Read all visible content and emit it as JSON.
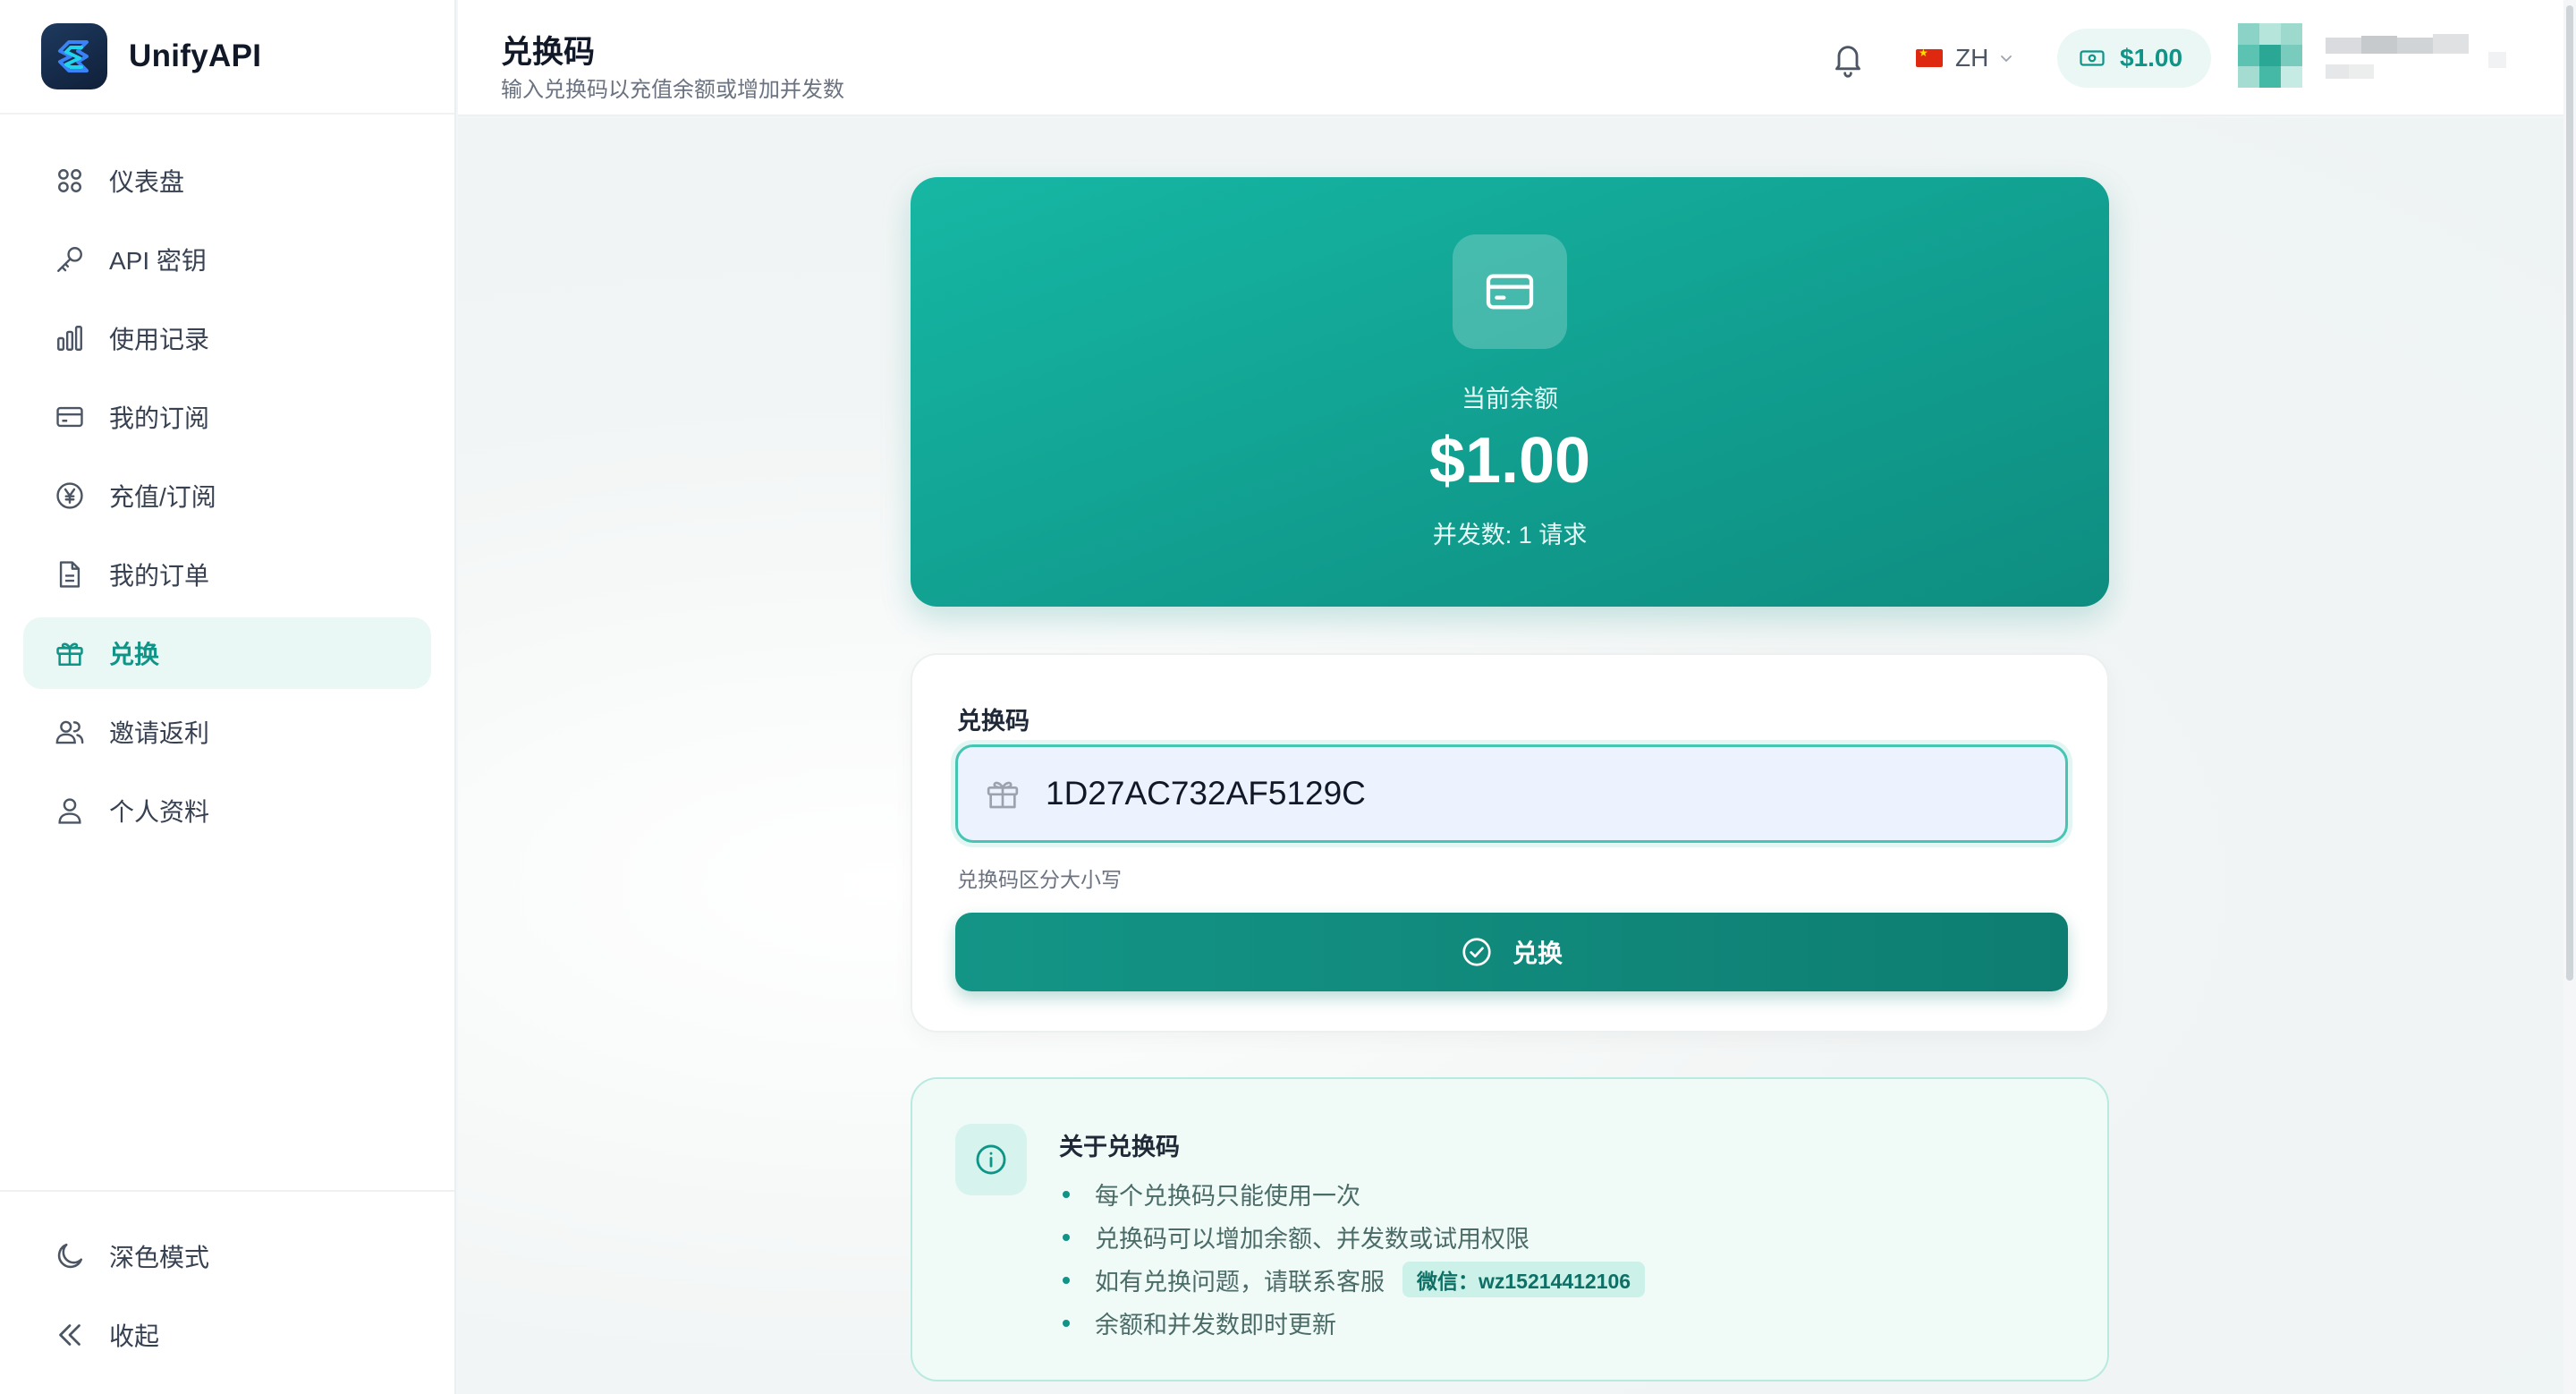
{
  "app": {
    "name": "UnifyAPI"
  },
  "header": {
    "title": "兑换码",
    "subtitle": "输入兑换码以充值余额或增加并发数",
    "language": "ZH",
    "balance": "$1.00"
  },
  "sidebar": {
    "items": [
      {
        "label": "仪表盘",
        "icon": "grid-icon",
        "active": false
      },
      {
        "label": "API 密钥",
        "icon": "key-icon",
        "active": false
      },
      {
        "label": "使用记录",
        "icon": "bar-chart-icon",
        "active": false
      },
      {
        "label": "我的订阅",
        "icon": "card-icon",
        "active": false
      },
      {
        "label": "充值/订阅",
        "icon": "yen-circle-icon",
        "active": false
      },
      {
        "label": "我的订单",
        "icon": "document-icon",
        "active": false
      },
      {
        "label": "兑换",
        "icon": "gift-icon",
        "active": true
      },
      {
        "label": "邀请返利",
        "icon": "users-icon",
        "active": false
      },
      {
        "label": "个人资料",
        "icon": "user-icon",
        "active": false
      }
    ],
    "bottom": [
      {
        "label": "深色模式",
        "icon": "moon-icon"
      },
      {
        "label": "收起",
        "icon": "double-chevron-left-icon"
      }
    ]
  },
  "balance_card": {
    "label": "当前余额",
    "amount": "$1.00",
    "concurrency": "并发数: 1 请求"
  },
  "redeem": {
    "field_label": "兑换码",
    "value": "1D27AC732AF5129C",
    "hint": "兑换码区分大小写",
    "button_label": "兑换"
  },
  "info": {
    "title": "关于兑换码",
    "items": [
      "每个兑换码只能使用一次",
      "兑换码可以增加余额、并发数或试用权限",
      "如有兑换问题，请联系客服",
      "余额和并发数即时更新"
    ],
    "wechat": "微信：wz15214412106"
  },
  "colors": {
    "accent": "#0f9488",
    "card_gradient_start": "#16b7a4",
    "card_gradient_end": "#0e8d80"
  }
}
